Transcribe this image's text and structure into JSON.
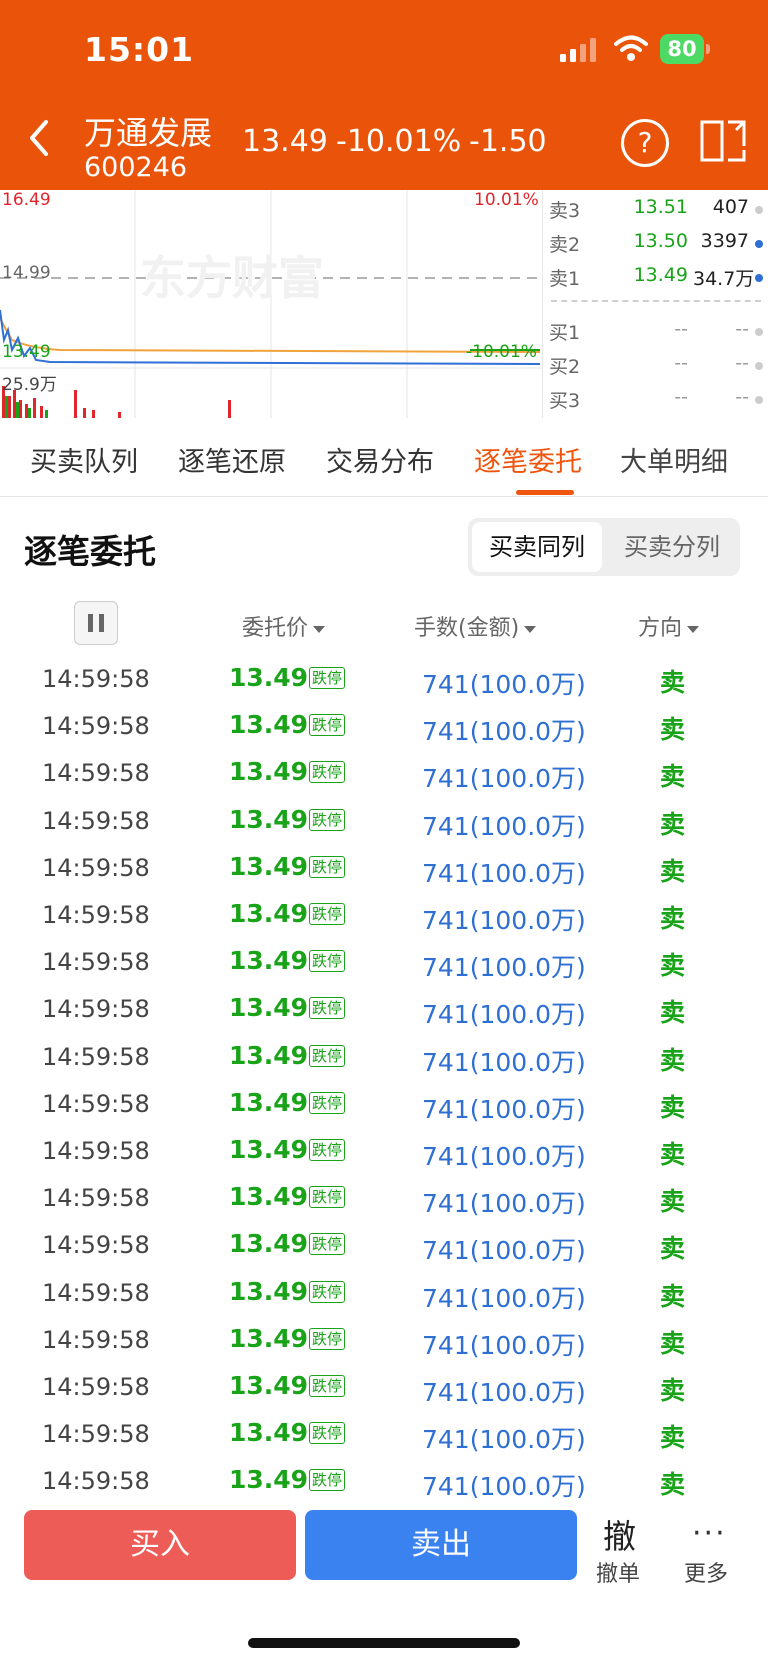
{
  "status": {
    "time": "15:01",
    "battery": "80"
  },
  "stock": {
    "name": "万通发展",
    "code": "600246",
    "price": "13.49",
    "pct": "-10.01%",
    "change": "-1.50"
  },
  "chart": {
    "high": "16.49",
    "high_pct": "10.01%",
    "prev_close": "14.99",
    "low": "13.49",
    "low_pct": "-10.01%",
    "vol": "25.9万",
    "watermark": "东方财富"
  },
  "book": {
    "sell": [
      {
        "label": "卖3",
        "price": "13.51",
        "vol": "407"
      },
      {
        "label": "卖2",
        "price": "13.50",
        "vol": "3397"
      },
      {
        "label": "卖1",
        "price": "13.49",
        "vol": "34.7万"
      }
    ],
    "buy": [
      {
        "label": "买1",
        "price": "--",
        "vol": "--"
      },
      {
        "label": "买2",
        "price": "--",
        "vol": "--"
      },
      {
        "label": "买3",
        "price": "--",
        "vol": "--"
      }
    ]
  },
  "tabs": [
    "买卖队列",
    "逐笔还原",
    "交易分布",
    "逐笔委托",
    "大单明细"
  ],
  "section": {
    "title": "逐笔委托",
    "seg_on": "买卖同列",
    "seg_off": "买卖分列"
  },
  "columns": {
    "price": "委托价",
    "lots": "手数(金额)",
    "dir": "方向"
  },
  "row": {
    "time": "14:59:58",
    "price": "13.49",
    "badge": "跌停",
    "lots": "741(100.0万)",
    "dir": "卖"
  },
  "rows_count": 18,
  "actions": {
    "buy": "买入",
    "sell": "卖出",
    "cancel_glyph": "撤",
    "cancel": "撤单",
    "more_glyph": "···",
    "more": "更多"
  },
  "colors": {
    "header": "#e9540a",
    "down": "#18a318",
    "up": "#e0262d",
    "blue": "#2d6fd2",
    "accent": "#f0550d"
  }
}
